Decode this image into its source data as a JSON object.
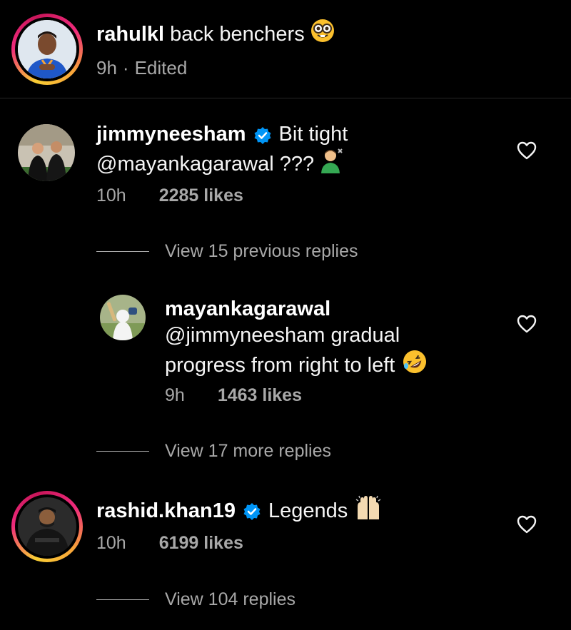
{
  "caption": {
    "username": "rahulkl",
    "text": "back benchers",
    "emoji_icon": "nerd-face-emoji",
    "time": "9h",
    "separator": "·",
    "edited": "Edited"
  },
  "comments": [
    {
      "username": "jimmyneesham",
      "verified": true,
      "text_line1": "Bit tight",
      "text_line2": "@mayankagarawal ???",
      "emoji_icon": "man-getting-haircut-emoji",
      "time": "10h",
      "likes": "2285 likes",
      "like_icon": "heart-icon"
    },
    {
      "username": "mayankagarawal",
      "verified": false,
      "text_line1": "@jimmyneesham gradual",
      "text_line2": "progress from right to left",
      "emoji_icon": "rolling-on-floor-laughing-emoji",
      "time": "9h",
      "likes": "1463 likes",
      "like_icon": "heart-icon"
    },
    {
      "username": "rashid.khan19",
      "verified": true,
      "text_line1": "Legends",
      "emoji_icon": "raising-hands-emoji",
      "time": "10h",
      "likes": "6199 likes",
      "like_icon": "heart-icon"
    }
  ],
  "replies_links": {
    "previous": "View 15 previous replies",
    "more": "View 17 more replies",
    "all": "View 104 replies"
  },
  "colors": {
    "background": "#000000",
    "text": "#f5f5f5",
    "muted": "#a8a8a8",
    "verified_blue": "#0095f6"
  }
}
